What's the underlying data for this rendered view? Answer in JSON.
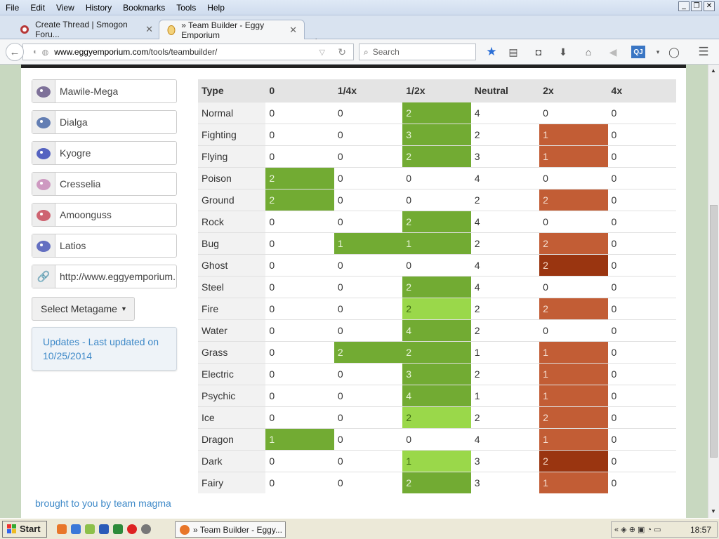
{
  "menu": [
    "File",
    "Edit",
    "View",
    "History",
    "Bookmarks",
    "Tools",
    "Help"
  ],
  "tabs": [
    {
      "title": "Create Thread | Smogon Foru...",
      "active": false
    },
    {
      "title": "» Team Builder - Eggy Emporium",
      "active": true
    }
  ],
  "address": {
    "host": "www.eggyemporium.com",
    "path": "/tools/teambuilder/"
  },
  "search_placeholder": "Search",
  "team": [
    "Mawile-Mega",
    "Dialga",
    "Kyogre",
    "Cresselia",
    "Amoonguss",
    "Latios"
  ],
  "share_link": "http://www.eggyemporium.",
  "metagame_button": "Select Metagame",
  "updates_text": "Updates - Last updated on 10/25/2014",
  "credit": "brought to you by team magma",
  "table": {
    "headers": [
      "Type",
      "0",
      "1/4x",
      "1/2x",
      "Neutral",
      "2x",
      "4x"
    ],
    "rows": [
      {
        "type": "Normal",
        "v": [
          "0",
          "0",
          "2",
          "4",
          "0",
          "0"
        ],
        "c": [
          "",
          "",
          "g",
          "",
          "",
          ""
        ]
      },
      {
        "type": "Fighting",
        "v": [
          "0",
          "0",
          "3",
          "2",
          "1",
          "0"
        ],
        "c": [
          "",
          "",
          "g",
          "",
          "o",
          ""
        ]
      },
      {
        "type": "Flying",
        "v": [
          "0",
          "0",
          "2",
          "3",
          "1",
          "0"
        ],
        "c": [
          "",
          "",
          "g",
          "",
          "o",
          ""
        ]
      },
      {
        "type": "Poison",
        "v": [
          "2",
          "0",
          "0",
          "4",
          "0",
          "0"
        ],
        "c": [
          "g",
          "",
          "",
          "",
          "",
          ""
        ]
      },
      {
        "type": "Ground",
        "v": [
          "2",
          "0",
          "0",
          "2",
          "2",
          "0"
        ],
        "c": [
          "g",
          "",
          "",
          "",
          "o",
          ""
        ]
      },
      {
        "type": "Rock",
        "v": [
          "0",
          "0",
          "2",
          "4",
          "0",
          "0"
        ],
        "c": [
          "",
          "",
          "g",
          "",
          "",
          ""
        ]
      },
      {
        "type": "Bug",
        "v": [
          "0",
          "1",
          "1",
          "2",
          "2",
          "0"
        ],
        "c": [
          "",
          "g",
          "g",
          "",
          "o",
          ""
        ]
      },
      {
        "type": "Ghost",
        "v": [
          "0",
          "0",
          "0",
          "4",
          "2",
          "0"
        ],
        "c": [
          "",
          "",
          "",
          "",
          "dr",
          ""
        ]
      },
      {
        "type": "Steel",
        "v": [
          "0",
          "0",
          "2",
          "4",
          "0",
          "0"
        ],
        "c": [
          "",
          "",
          "g",
          "",
          "",
          ""
        ]
      },
      {
        "type": "Fire",
        "v": [
          "0",
          "0",
          "2",
          "2",
          "2",
          "0"
        ],
        "c": [
          "",
          "",
          "lg",
          "",
          "o",
          ""
        ]
      },
      {
        "type": "Water",
        "v": [
          "0",
          "0",
          "4",
          "2",
          "0",
          "0"
        ],
        "c": [
          "",
          "",
          "g",
          "",
          "",
          ""
        ]
      },
      {
        "type": "Grass",
        "v": [
          "0",
          "2",
          "2",
          "1",
          "1",
          "0"
        ],
        "c": [
          "",
          "g",
          "g",
          "",
          "o",
          ""
        ]
      },
      {
        "type": "Electric",
        "v": [
          "0",
          "0",
          "3",
          "2",
          "1",
          "0"
        ],
        "c": [
          "",
          "",
          "g",
          "",
          "o",
          ""
        ]
      },
      {
        "type": "Psychic",
        "v": [
          "0",
          "0",
          "4",
          "1",
          "1",
          "0"
        ],
        "c": [
          "",
          "",
          "g",
          "",
          "o",
          ""
        ]
      },
      {
        "type": "Ice",
        "v": [
          "0",
          "0",
          "2",
          "2",
          "2",
          "0"
        ],
        "c": [
          "",
          "",
          "lg",
          "",
          "o",
          ""
        ]
      },
      {
        "type": "Dragon",
        "v": [
          "1",
          "0",
          "0",
          "4",
          "1",
          "0"
        ],
        "c": [
          "g",
          "",
          "",
          "",
          "o",
          ""
        ]
      },
      {
        "type": "Dark",
        "v": [
          "0",
          "0",
          "1",
          "3",
          "2",
          "0"
        ],
        "c": [
          "",
          "",
          "lg",
          "",
          "dr",
          ""
        ]
      },
      {
        "type": "Fairy",
        "v": [
          "0",
          "0",
          "2",
          "3",
          "1",
          "0"
        ],
        "c": [
          "",
          "",
          "g",
          "",
          "o",
          ""
        ]
      }
    ]
  },
  "taskbar": {
    "start": "Start",
    "task": "» Team Builder - Eggy...",
    "clock": "18:57"
  }
}
